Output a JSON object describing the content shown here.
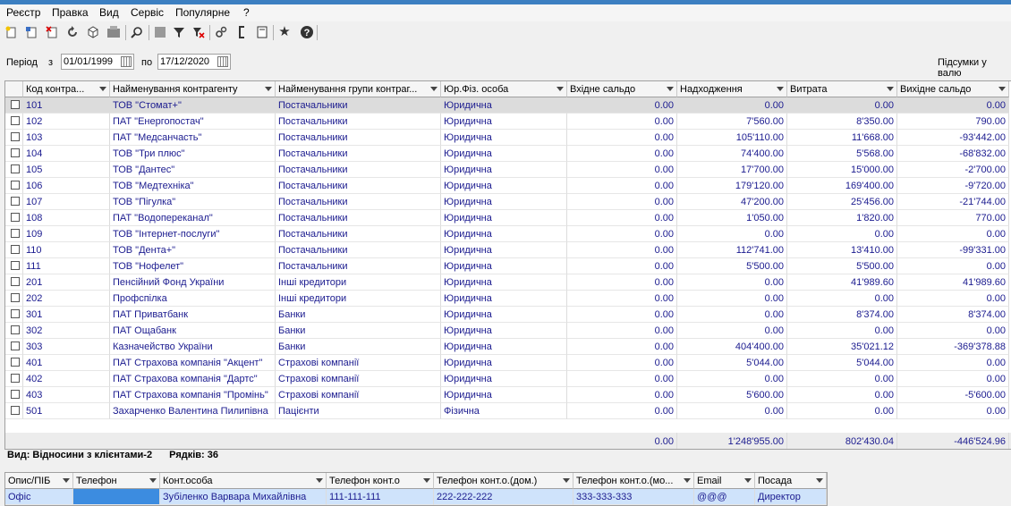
{
  "menu": [
    "Реєстр",
    "Правка",
    "Вид",
    "Сервіс",
    "Популярне",
    "?"
  ],
  "toolbar_icons": [
    "new-doc-icon",
    "copy-doc-icon",
    "delete-doc-icon",
    "refresh-icon",
    "package-icon",
    "print-icon",
    "search-icon",
    "block-icon",
    "filter-icon",
    "clear-filter-icon",
    "settings-icon",
    "bracket-icon",
    "document-icon",
    "star-icon",
    "help-icon"
  ],
  "period": {
    "label": "Період",
    "from_label": "з",
    "from": "01/01/1999",
    "to_label": "по",
    "to": "17/12/2020",
    "totals_label": "Підсумки у валю"
  },
  "grid": {
    "columns": [
      "Код контра...",
      "Найменування контрагенту",
      "Найменування групи контраг...",
      "Юр.Фіз. особа",
      "Вхідне сальдо",
      "Надходження",
      "Витрата",
      "Вихідне сальдо"
    ],
    "rows": [
      {
        "code": "101",
        "name": "ТОВ \"Стомат+\"",
        "group": "Постачальники",
        "type": "Юридична",
        "open": "0.00",
        "income": "0.00",
        "expense": "0.00",
        "close": "0.00"
      },
      {
        "code": "102",
        "name": "ПАТ \"Енергопостач\"",
        "group": "Постачальники",
        "type": "Юридична",
        "open": "0.00",
        "income": "7'560.00",
        "expense": "8'350.00",
        "close": "790.00"
      },
      {
        "code": "103",
        "name": "ПАТ \"Медсанчасть\"",
        "group": "Постачальники",
        "type": "Юридична",
        "open": "0.00",
        "income": "105'110.00",
        "expense": "11'668.00",
        "close": "-93'442.00"
      },
      {
        "code": "104",
        "name": "ТОВ \"Три плюс\"",
        "group": "Постачальники",
        "type": "Юридична",
        "open": "0.00",
        "income": "74'400.00",
        "expense": "5'568.00",
        "close": "-68'832.00"
      },
      {
        "code": "105",
        "name": "ТОВ \"Дантес\"",
        "group": "Постачальники",
        "type": "Юридична",
        "open": "0.00",
        "income": "17'700.00",
        "expense": "15'000.00",
        "close": "-2'700.00"
      },
      {
        "code": "106",
        "name": "ТОВ \"Медтехніка\"",
        "group": "Постачальники",
        "type": "Юридична",
        "open": "0.00",
        "income": "179'120.00",
        "expense": "169'400.00",
        "close": "-9'720.00"
      },
      {
        "code": "107",
        "name": "ТОВ \"Пігулка\"",
        "group": "Постачальники",
        "type": "Юридична",
        "open": "0.00",
        "income": "47'200.00",
        "expense": "25'456.00",
        "close": "-21'744.00"
      },
      {
        "code": "108",
        "name": "ПАТ \"Водопереканал\"",
        "group": "Постачальники",
        "type": "Юридична",
        "open": "0.00",
        "income": "1'050.00",
        "expense": "1'820.00",
        "close": "770.00"
      },
      {
        "code": "109",
        "name": "ТОВ \"Інтернет-послуги\"",
        "group": "Постачальники",
        "type": "Юридична",
        "open": "0.00",
        "income": "0.00",
        "expense": "0.00",
        "close": "0.00"
      },
      {
        "code": "110",
        "name": "ТОВ \"Дента+\"",
        "group": "Постачальники",
        "type": "Юридична",
        "open": "0.00",
        "income": "112'741.00",
        "expense": "13'410.00",
        "close": "-99'331.00"
      },
      {
        "code": "111",
        "name": "ТОВ \"Нофелет\"",
        "group": "Постачальники",
        "type": "Юридична",
        "open": "0.00",
        "income": "5'500.00",
        "expense": "5'500.00",
        "close": "0.00"
      },
      {
        "code": "201",
        "name": "Пенсійний Фонд України",
        "group": "Інші кредитори",
        "type": "Юридична",
        "open": "0.00",
        "income": "0.00",
        "expense": "41'989.60",
        "close": "41'989.60"
      },
      {
        "code": "202",
        "name": "Профспілка",
        "group": "Інші кредитори",
        "type": "Юридична",
        "open": "0.00",
        "income": "0.00",
        "expense": "0.00",
        "close": "0.00"
      },
      {
        "code": "301",
        "name": "ПАТ Приватбанк",
        "group": "Банки",
        "type": "Юридична",
        "open": "0.00",
        "income": "0.00",
        "expense": "8'374.00",
        "close": "8'374.00"
      },
      {
        "code": "302",
        "name": "ПАТ Ощабанк",
        "group": "Банки",
        "type": "Юридична",
        "open": "0.00",
        "income": "0.00",
        "expense": "0.00",
        "close": "0.00"
      },
      {
        "code": "303",
        "name": "Казначейство України",
        "group": "Банки",
        "type": "Юридична",
        "open": "0.00",
        "income": "404'400.00",
        "expense": "35'021.12",
        "close": "-369'378.88"
      },
      {
        "code": "401",
        "name": "ПАТ Страхова компанія \"Акцент\"",
        "group": "Страхові компанії",
        "type": "Юридична",
        "open": "0.00",
        "income": "5'044.00",
        "expense": "5'044.00",
        "close": "0.00"
      },
      {
        "code": "402",
        "name": "ПАТ Страхова компанія \"Дартс\"",
        "group": "Страхові компанії",
        "type": "Юридична",
        "open": "0.00",
        "income": "0.00",
        "expense": "0.00",
        "close": "0.00"
      },
      {
        "code": "403",
        "name": "ПАТ Страхова компанія \"Промінь\"",
        "group": "Страхові компанії",
        "type": "Юридична",
        "open": "0.00",
        "income": "5'600.00",
        "expense": "0.00",
        "close": "-5'600.00"
      },
      {
        "code": "501",
        "name": "Захарченко Валентина Пилипівна",
        "group": "Пацієнти",
        "type": "Фізична",
        "open": "0.00",
        "income": "0.00",
        "expense": "0.00",
        "close": "0.00"
      }
    ],
    "totals": {
      "open": "0.00",
      "income": "1'248'955.00",
      "expense": "802'430.04",
      "close": "-446'524.96"
    }
  },
  "status": {
    "view": "Вид: Відносини з клієнтами-2",
    "rows": "Рядків: 36"
  },
  "contacts": {
    "columns": [
      "Опис/ПІБ",
      "Телефон",
      "Конт.особа",
      "Телефон конт.о",
      "Телефон конт.о.(дом.)",
      "Телефон конт.о.(мо...",
      "Email",
      "Посада"
    ],
    "row": [
      "Офіс",
      "",
      "Зубіленко Варвара Михайлівна",
      "111-111-111",
      "222-222-222",
      "333-333-333",
      "@@@",
      "Директор"
    ]
  }
}
